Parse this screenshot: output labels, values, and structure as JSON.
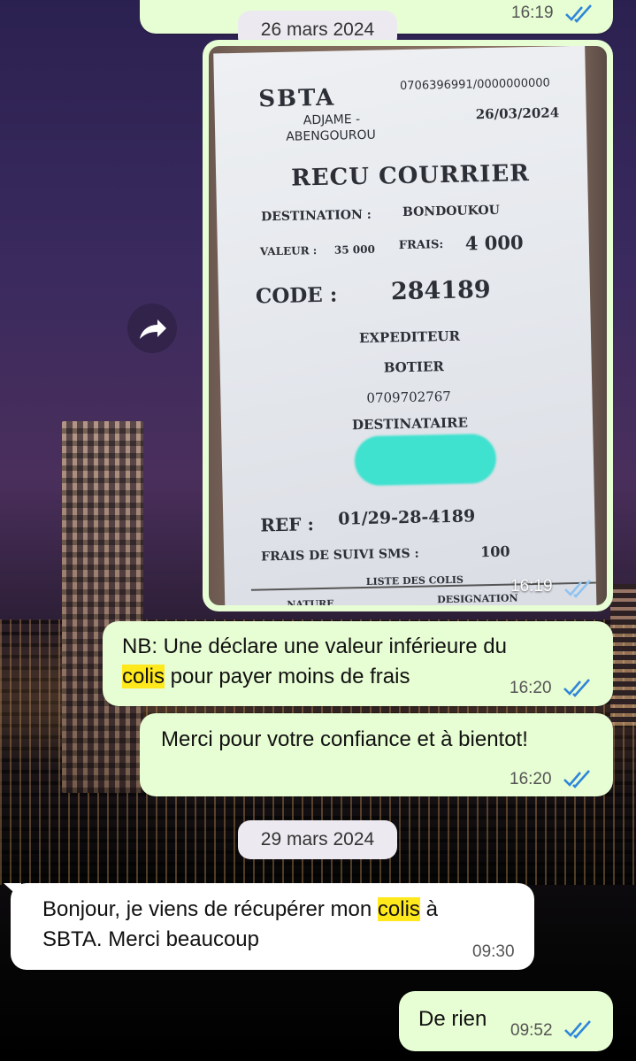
{
  "colors": {
    "outgoing_bubble": "#e7fdd3",
    "incoming_bubble": "#ffffff",
    "read_ticks": "#2e86d9",
    "highlight": "#ffe81c",
    "date_pill": "#eceaf0"
  },
  "top_partial_message": {
    "time": "16:19",
    "status_icon": "double-check-icon"
  },
  "date_separator_1": "26 mars 2024",
  "image_message": {
    "time": "16:19",
    "status_icon": "double-check-icon",
    "receipt": {
      "company": "SBTA",
      "phones": "0706396991/0000000000",
      "route_line1": "ADJAME -",
      "route_line2": "ABENGOUROU",
      "date": "26/03/2024",
      "title": "RECU COURRIER",
      "destination_label": "DESTINATION :",
      "destination_value": "BONDOUKOU",
      "valeur_label": "VALEUR :",
      "valeur_value": "35 000",
      "frais_label": "FRAIS:",
      "frais_value": "4 000",
      "code_label": "CODE :",
      "code_value": "284189",
      "expediteur_label": "EXPEDITEUR",
      "expediteur_name": "BOTIER",
      "expediteur_phone": "0709702767",
      "destinataire_label": "DESTINATAIRE",
      "ref_label": "REF :",
      "ref_value": "01/29-28-4189",
      "sms_label": "FRAIS DE SUIVI SMS :",
      "sms_value": "100",
      "liste_label": "LISTE DES COLIS",
      "col_nature": "NATURE",
      "col_designation": "DESIGNATION"
    }
  },
  "forward_icon": "share-arrow-icon",
  "messages": [
    {
      "direction": "outgoing",
      "line1": "NB: Une déclare une valeur inférieure du",
      "line2_highlight": "colis",
      "line2_rest": " pour payer moins de frais",
      "time": "16:20"
    },
    {
      "direction": "outgoing",
      "text": "Merci pour votre confiance et à bientot!",
      "time": "16:20"
    }
  ],
  "date_separator_2": "29 mars 2024",
  "incoming_message": {
    "line1_start": "Bonjour, je viens de récupérer mon ",
    "line1_highlight": "colis",
    "line1_end": " à",
    "line2": "SBTA. Merci beaucoup",
    "time": "09:30"
  },
  "last_message": {
    "text": "De rien",
    "time": "09:52"
  }
}
